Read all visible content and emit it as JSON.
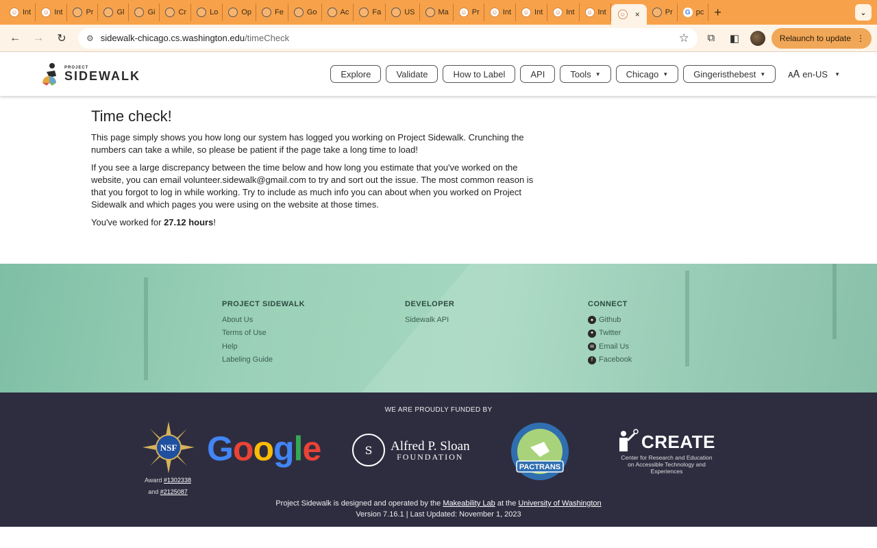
{
  "browser": {
    "tabs": [
      {
        "label": "Int",
        "fav": "ps"
      },
      {
        "label": "Int",
        "fav": "ps"
      },
      {
        "label": "Pr",
        "fav": "cs"
      },
      {
        "label": "Gl",
        "fav": "cs"
      },
      {
        "label": "Gi",
        "fav": "cs"
      },
      {
        "label": "Cr",
        "fav": "cs"
      },
      {
        "label": "Lo",
        "fav": "cs"
      },
      {
        "label": "Op",
        "fav": "cs"
      },
      {
        "label": "Fe",
        "fav": "cs"
      },
      {
        "label": "Go",
        "fav": "cs"
      },
      {
        "label": "Ac",
        "fav": "cs"
      },
      {
        "label": "Fa",
        "fav": "cs"
      },
      {
        "label": "US",
        "fav": "cs"
      },
      {
        "label": "Ma",
        "fav": "cs"
      },
      {
        "label": "Pr",
        "fav": "ps"
      },
      {
        "label": "Int",
        "fav": "ps"
      },
      {
        "label": "Int",
        "fav": "ps"
      },
      {
        "label": "Int",
        "fav": "ps"
      },
      {
        "label": "Int",
        "fav": "ps"
      }
    ],
    "active_tab": {
      "close": "×"
    },
    "tabs_after": [
      {
        "label": "Pr",
        "fav": "cs"
      },
      {
        "label": "pc",
        "fav": "g"
      }
    ],
    "url_host": "sidewalk-chicago.cs.washington.edu",
    "url_path": "/timeCheck",
    "relaunch_label": "Relaunch to update"
  },
  "site": {
    "logo_small": "PROJECT",
    "logo_big": "SIDEWALK",
    "nav": {
      "explore": "Explore",
      "validate": "Validate",
      "how_to_label": "How to Label",
      "api": "API",
      "tools": "Tools",
      "city": "Chicago",
      "user": "Gingeristhebest",
      "language": "en-US"
    }
  },
  "content": {
    "title": "Time check!",
    "para1": "This page simply shows you how long our system has logged you working on Project Sidewalk. Crunching the numbers can take a while, so please be patient if the page take a long time to load!",
    "para2": "If you see a large discrepancy between the time below and how long you estimate that you've worked on the website, you can email volunteer.sidewalk@gmail.com to try and sort out the issue. The most common reason is that you forgot to log in while working. Try to include as much info you can about when you worked on Project Sidewalk and which pages you were using on the website at those times.",
    "worked_prefix": "You've worked for ",
    "worked_hours": "27.12 hours",
    "worked_suffix": "!"
  },
  "footer": {
    "col1": {
      "heading": "PROJECT SIDEWALK",
      "links": [
        "About Us",
        "Terms of Use",
        "Help",
        "Labeling Guide"
      ]
    },
    "col2": {
      "heading": "DEVELOPER",
      "links": [
        "Sidewalk API"
      ]
    },
    "col3": {
      "heading": "CONNECT",
      "links": [
        "Github",
        "Twitter",
        "Email Us",
        "Facebook"
      ]
    },
    "funded_by": "WE ARE PROUDLY FUNDED BY",
    "nsf": {
      "award_prefix": "Award ",
      "award1": "#1302338",
      "and": "and ",
      "award2": "#2125087"
    },
    "google": "Google",
    "sloan": {
      "line1": "Alfred P. Sloan",
      "line2": "FOUNDATION"
    },
    "create": {
      "word": "CREATE",
      "sub": "Center for Research and Education on Accessible Technology and Experiences"
    },
    "credits": {
      "prefix": "Project Sidewalk is designed and operated by the ",
      "lab": "Makeability Lab",
      "middle": " at the ",
      "uni": "University of Washington",
      "version": "Version 7.16.1 | Last Updated: November 1, 2023"
    }
  }
}
